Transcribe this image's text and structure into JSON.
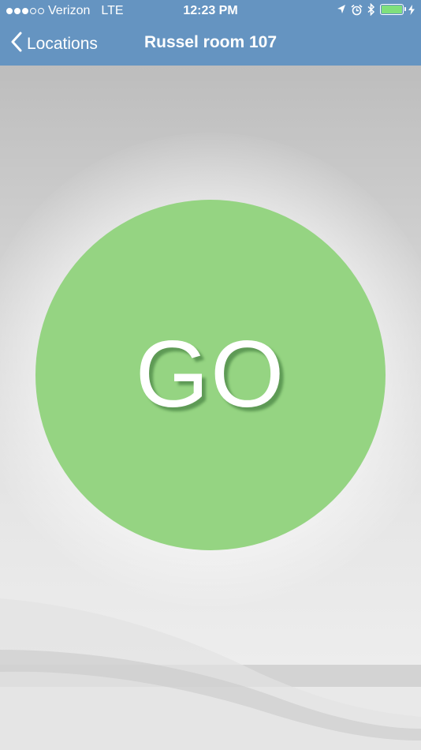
{
  "status_bar": {
    "carrier": "Verizon",
    "network": "LTE",
    "time": "12:23 PM",
    "signal_bars": 3,
    "signal_total": 5,
    "battery_level": 1.0
  },
  "nav": {
    "back_label": "Locations",
    "title": "Russel room 107"
  },
  "go_button": {
    "label": "GO",
    "color": "#95d482"
  },
  "colors": {
    "header": "#6594c1",
    "battery": "#7fe07c"
  },
  "icons": {
    "back": "chevron-left-icon",
    "location": "location-arrow-icon",
    "alarm": "alarm-clock-icon",
    "bluetooth": "bluetooth-icon",
    "battery": "battery-icon",
    "charging": "charging-bolt-icon"
  }
}
